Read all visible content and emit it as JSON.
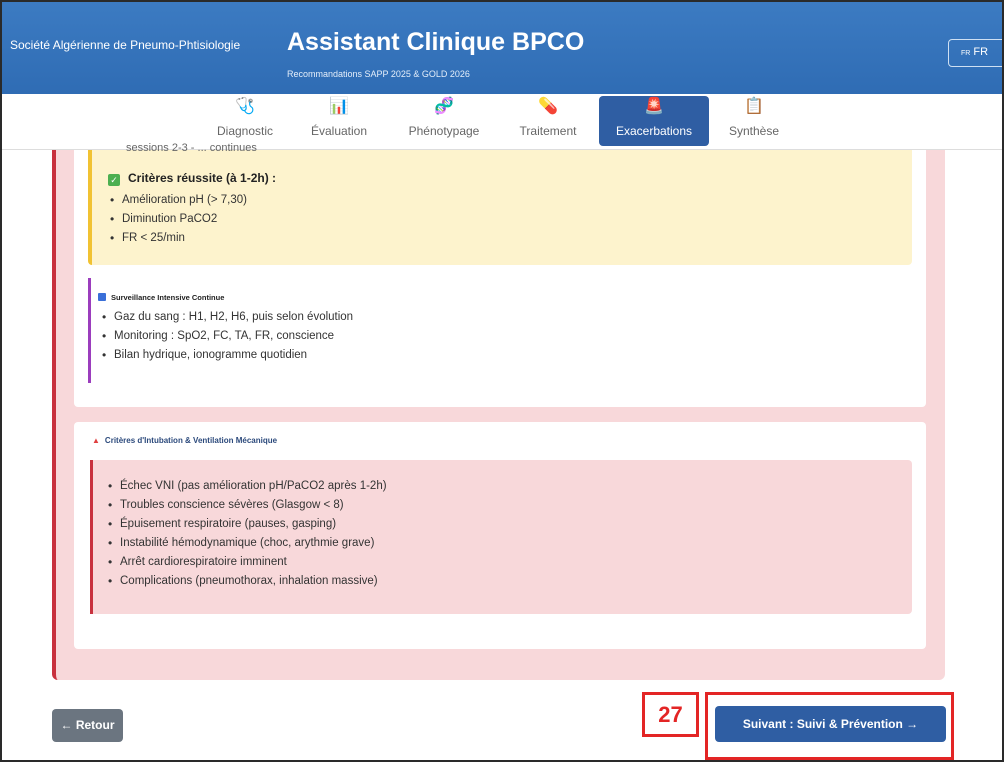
{
  "header": {
    "org": "Société Algérienne de Pneumo-Phtisiologie",
    "title": "Assistant Clinique BPCO",
    "subtitle": "Recommandations SAPP 2025 & GOLD 2026",
    "lang_flag": "FR",
    "lang_label": "FR"
  },
  "nav": {
    "tabs": [
      {
        "label": "Diagnostic",
        "icon": "stethoscope-icon",
        "glyph": "🩺"
      },
      {
        "label": "Évaluation",
        "icon": "bar-chart-icon",
        "glyph": "📊"
      },
      {
        "label": "Phénotypage",
        "icon": "dna-icon",
        "glyph": "🧬"
      },
      {
        "label": "Traitement",
        "icon": "pill-icon",
        "glyph": "💊"
      },
      {
        "label": "Exacerbations",
        "icon": "siren-icon",
        "glyph": "🚨",
        "active": true
      },
      {
        "label": "Synthèse",
        "icon": "clipboard-icon",
        "glyph": "📋"
      }
    ]
  },
  "ventilation": {
    "cut_text": "sessions 2-3 - ... continues",
    "success_title": "Critères réussite (à 1-2h) :",
    "success_items": [
      "Amélioration pH (> 7,30)",
      "Diminution PaCO2",
      "FR < 25/min"
    ]
  },
  "surveillance": {
    "title": "Surveillance Intensive Continue",
    "items": [
      "Gaz du sang : H1, H2, H6, puis selon évolution",
      "Monitoring : SpO2, FC, TA, FR, conscience",
      "Bilan hydrique, ionogramme quotidien"
    ]
  },
  "intubation": {
    "title": "Critères d'Intubation & Ventilation Mécanique",
    "items": [
      "Échec VNI (pas amélioration pH/PaCO2 après 1-2h)",
      "Troubles conscience sévères (Glasgow < 8)",
      "Épuisement respiratoire (pauses, gasping)",
      "Instabilité hémodynamique (choc, arythmie grave)",
      "Arrêt cardiorespiratoire imminent",
      "Complications (pneumothorax, inhalation massive)"
    ]
  },
  "footer": {
    "back_label": "← Retour",
    "next_label": "Suivant : Suivi & Prévention →",
    "marker_number": "27"
  },
  "colors": {
    "header_blue": "#2f6cb4",
    "active_tab": "#2f5ea3",
    "alert_red": "#c8313e",
    "annotation_red": "#e32525"
  }
}
